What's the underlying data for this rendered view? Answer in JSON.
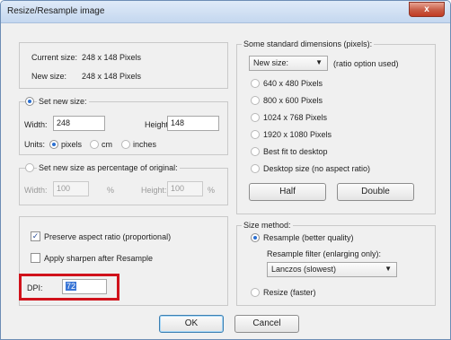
{
  "window": {
    "title": "Resize/Resample image",
    "close_label": "x"
  },
  "size_info": {
    "current_label": "Current size:",
    "current_value": "248 x 148 Pixels",
    "new_label": "New size:",
    "new_value": "248 x 148 Pixels"
  },
  "set_new_size": {
    "label": "Set new size:",
    "width_label": "Width:",
    "width_value": "248",
    "height_label": "Height:",
    "height_value": "148",
    "units_label": "Units:",
    "unit_pixels": "pixels",
    "unit_cm": "cm",
    "unit_inches": "inches"
  },
  "percentage": {
    "label": "Set new size as percentage of original:",
    "width_label": "Width:",
    "width_value": "100",
    "width_unit": "%",
    "height_label": "Height:",
    "height_value": "100",
    "height_unit": "%"
  },
  "options": {
    "preserve_label": "Preserve aspect ratio (proportional)",
    "sharpen_label": "Apply sharpen after Resample",
    "dpi_label": "DPI:",
    "dpi_value": "72"
  },
  "standard_dims": {
    "label": "Some standard dimensions (pixels):",
    "select_value": "New size:",
    "select_note": "(ratio option used)",
    "options": [
      "640 x 480 Pixels",
      "800 x 600 Pixels",
      "1024 x 768 Pixels",
      "1920 x 1080 Pixels",
      "Best fit to desktop",
      "Desktop size (no aspect ratio)"
    ],
    "half_label": "Half",
    "double_label": "Double"
  },
  "size_method": {
    "label": "Size method:",
    "resample_label": "Resample (better quality)",
    "filter_label": "Resample filter (enlarging only):",
    "filter_value": "Lanczos (slowest)",
    "resize_label": "Resize (faster)"
  },
  "buttons": {
    "ok": "OK",
    "cancel": "Cancel"
  },
  "check_mark": "✓",
  "dropdown_arrow": "▼",
  "colors": {
    "highlight": "#d0121b",
    "accent": "#2a6fd1"
  }
}
